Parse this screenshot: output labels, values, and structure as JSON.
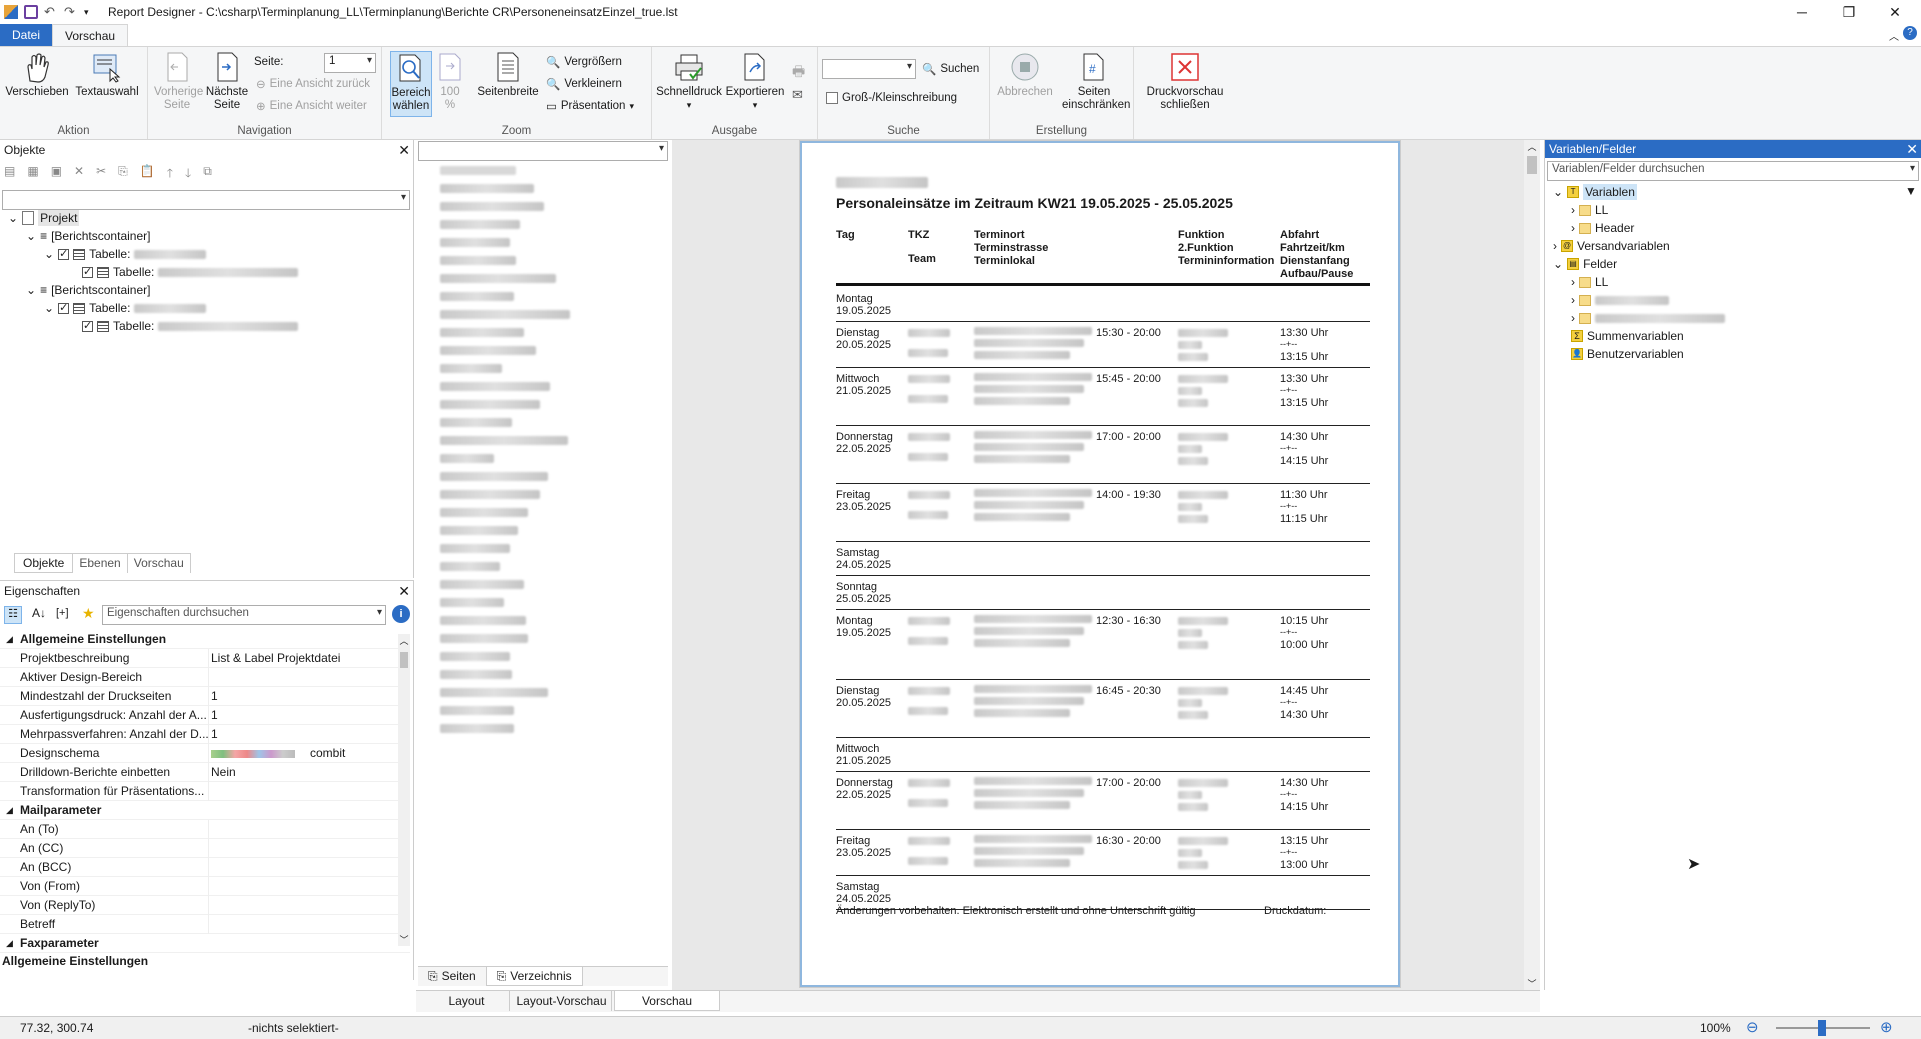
{
  "window": {
    "title": "Report Designer - C:\\csharp\\Terminplanung_LL\\Terminplanung\\Berichte CR\\PersoneneinsatzEinzel_true.lst"
  },
  "ribbon_tabs": [
    "Datei",
    "Vorschau"
  ],
  "ribbon": {
    "aktion": {
      "label": "Aktion",
      "verschieben": "Verschieben",
      "textauswahl": "Textauswahl"
    },
    "navigation": {
      "label": "Navigation",
      "vorherige": "Vorherige Seite",
      "naechste": "Nächste Seite",
      "seite_label": "Seite:",
      "seite_value": "1",
      "zurueck": "Eine Ansicht zurück",
      "weiter": "Eine Ansicht weiter"
    },
    "zoom": {
      "label": "Zoom",
      "bereich": "Bereich wählen",
      "hundert": "100 %",
      "seitenbreite": "Seitenbreite",
      "vergroessern": "Vergrößern",
      "verkleinern": "Verkleinern",
      "praesentation": "Präsentation"
    },
    "ausgabe": {
      "label": "Ausgabe",
      "schnelldruck": "Schnelldruck",
      "exportieren": "Exportieren"
    },
    "suche": {
      "label": "Suche",
      "suchen": "Suchen",
      "gross_klein": "Groß-/Kleinschreibung"
    },
    "erstellung": {
      "label": "Erstellung",
      "abbrechen": "Abbrechen",
      "seiten": "Seiten einschränken"
    },
    "close": {
      "label": "Druckvorschau schließen"
    }
  },
  "objekte": {
    "title": "Objekte",
    "tree": [
      "Projekt",
      "[Berichtscontainer]",
      "Tabelle:",
      "Tabelle:",
      "[Berichtscontainer]",
      "Tabelle:",
      "Tabelle:"
    ],
    "tabs": [
      "Objekte",
      "Ebenen",
      "Vorschau"
    ]
  },
  "eigenschaften": {
    "title": "Eigenschaften",
    "search_placeholder": "Eigenschaften durchsuchen",
    "rows": [
      {
        "k": "Allgemeine Einstellungen",
        "v": "",
        "section": true
      },
      {
        "k": "Projektbeschreibung",
        "v": "List & Label Projektdatei"
      },
      {
        "k": "Aktiver Design-Bereich",
        "v": ""
      },
      {
        "k": "Mindestzahl der Druckseiten",
        "v": "1"
      },
      {
        "k": "Ausfertigungsdruck: Anzahl der A...",
        "v": "1"
      },
      {
        "k": "Mehrpassverfahren: Anzahl der D...",
        "v": "1"
      },
      {
        "k": "Designschema",
        "v": "combit"
      },
      {
        "k": "Drilldown-Berichte einbetten",
        "v": "Nein"
      },
      {
        "k": "Transformation für Präsentations...",
        "v": ""
      },
      {
        "k": "Mailparameter",
        "v": "",
        "section": true
      },
      {
        "k": "An (To)",
        "v": ""
      },
      {
        "k": "An (CC)",
        "v": ""
      },
      {
        "k": "An (BCC)",
        "v": ""
      },
      {
        "k": "Von (From)",
        "v": ""
      },
      {
        "k": "Von (ReplyTo)",
        "v": ""
      },
      {
        "k": "Betreff",
        "v": ""
      },
      {
        "k": "Faxparameter",
        "v": "",
        "section": true
      }
    ],
    "footer": "Allgemeine Einstellungen"
  },
  "list_tabs": [
    "Seiten",
    "Verzeichnis"
  ],
  "report": {
    "title": "Personaleinsätze im Zeitraum KW21 19.05.2025 - 25.05.2025",
    "headers": {
      "tag": "Tag",
      "tkz": "TKZ",
      "team": "Team",
      "ort": "Terminort\nTerminstrasse\nTerminlokal",
      "funktion": "Funktion\n2.Funktion\nTermininformation",
      "abfahrt": "Abfahrt\nFahrtzeit/km\nDienstanfang\nAufbau/Pause"
    },
    "rows": [
      {
        "day": "Montag",
        "date": "19.05.2025",
        "time": "",
        "a1": "",
        "a2": ""
      },
      {
        "day": "Dienstag",
        "date": "20.05.2025",
        "time": "15:30 - 20:00",
        "a1": "13:30 Uhr",
        "a2": "13:15 Uhr"
      },
      {
        "day": "Mittwoch",
        "date": "21.05.2025",
        "time": "15:45 - 20:00",
        "a1": "13:30 Uhr",
        "a2": "13:15 Uhr"
      },
      {
        "day": "Donnerstag",
        "date": "22.05.2025",
        "time": "17:00 - 20:00",
        "a1": "14:30 Uhr",
        "a2": "14:15 Uhr"
      },
      {
        "day": "Freitag",
        "date": "23.05.2025",
        "time": "14:00 - 19:30",
        "a1": "11:30 Uhr",
        "a2": "11:15 Uhr"
      },
      {
        "day": "Samstag",
        "date": "24.05.2025",
        "time": "",
        "a1": "",
        "a2": ""
      },
      {
        "day": "Sonntag",
        "date": "25.05.2025",
        "time": "",
        "a1": "",
        "a2": ""
      },
      {
        "day": "Montag",
        "date": "19.05.2025",
        "time": "12:30 - 16:30",
        "a1": "10:15 Uhr",
        "a2": "10:00 Uhr"
      },
      {
        "day": "Dienstag",
        "date": "20.05.2025",
        "time": "16:45 - 20:30",
        "a1": "14:45 Uhr",
        "a2": "14:30 Uhr"
      },
      {
        "day": "Mittwoch",
        "date": "21.05.2025",
        "time": "",
        "a1": "",
        "a2": ""
      },
      {
        "day": "Donnerstag",
        "date": "22.05.2025",
        "time": "17:00 - 20:00",
        "a1": "14:30 Uhr",
        "a2": "14:15 Uhr"
      },
      {
        "day": "Freitag",
        "date": "23.05.2025",
        "time": "16:30 - 20:00",
        "a1": "13:15 Uhr",
        "a2": "13:00 Uhr"
      },
      {
        "day": "Samstag",
        "date": "24.05.2025",
        "time": "",
        "a1": "",
        "a2": ""
      }
    ],
    "dash": "--+--",
    "footer": "Änderungen vorbehalten. Elektronisch erstellt und ohne Unterschrift gültig",
    "druckdatum": "Druckdatum:"
  },
  "variablen": {
    "title": "Variablen/Felder",
    "search_placeholder": "Variablen/Felder durchsuchen",
    "tree": [
      "Variablen",
      "LL",
      "Header",
      "Versandvariablen",
      "Felder",
      "LL",
      "Summenvariablen",
      "Benutzervariablen"
    ]
  },
  "bottom_tabs": [
    "Layout",
    "Layout-Vorschau",
    "Vorschau"
  ],
  "status": {
    "coords": "77.32, 300.74",
    "selection": "-nichts selektiert-",
    "zoom": "100%"
  }
}
